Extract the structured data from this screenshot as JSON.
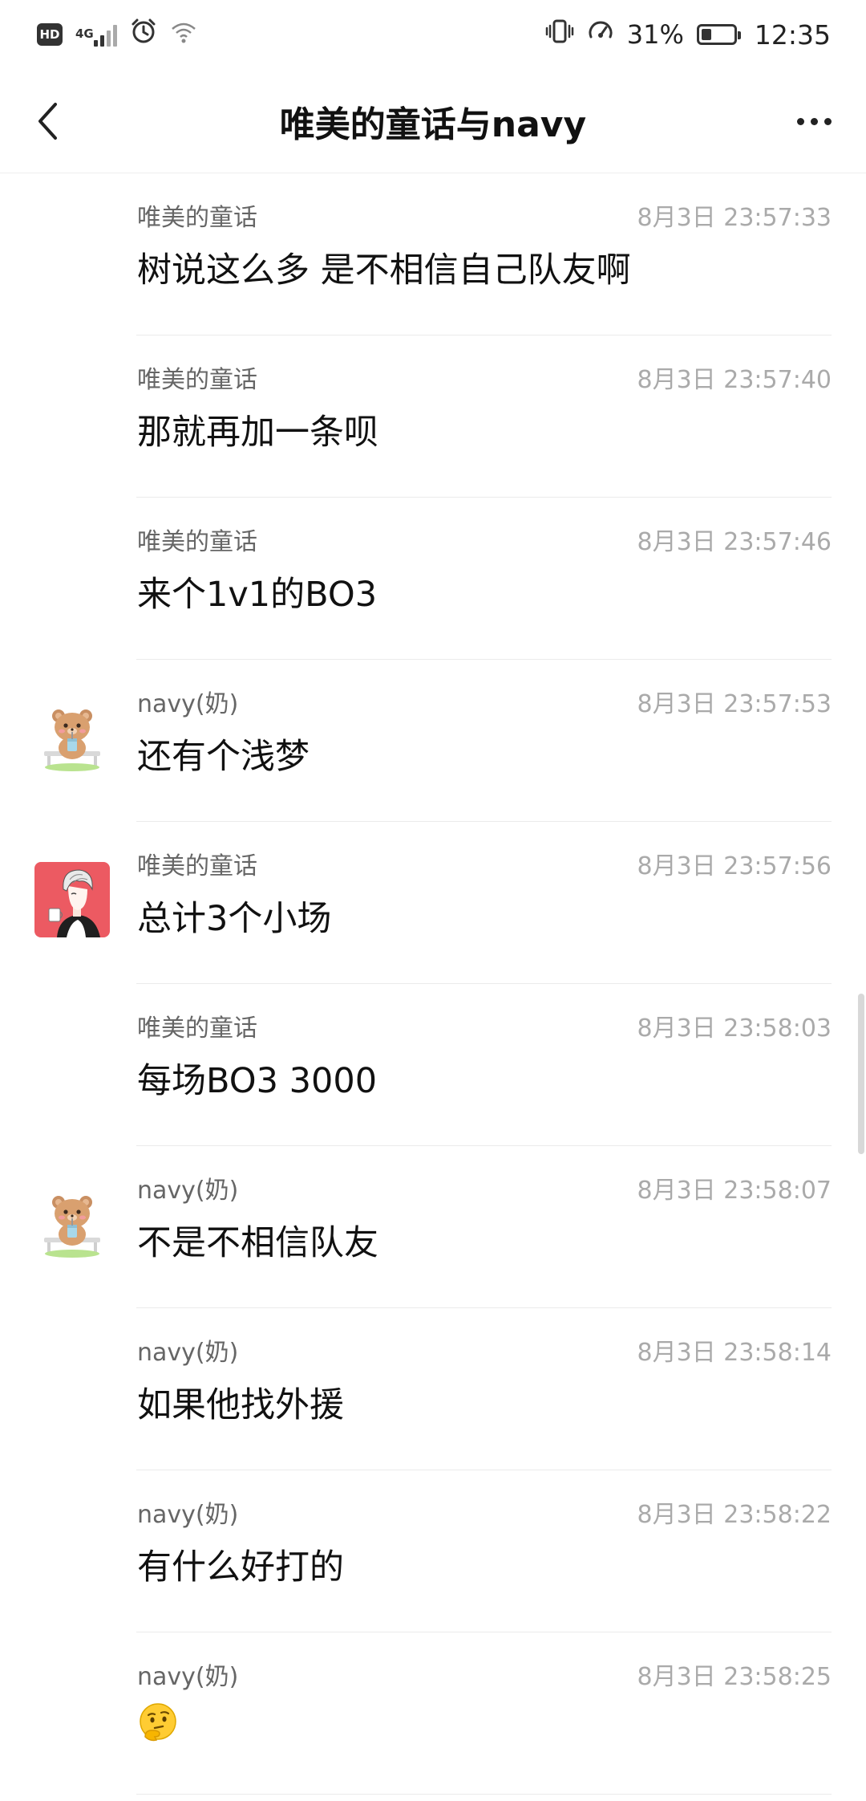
{
  "status_bar": {
    "hd": "HD",
    "network": "4G",
    "battery_percent": "31%",
    "battery_level": 0.31,
    "time": "12:35"
  },
  "header": {
    "title": "唯美的童话与navy"
  },
  "colors": {
    "text_primary": "#111111",
    "text_secondary": "#666666",
    "text_time": "#aaaaaa",
    "divider": "#ebebeb"
  },
  "messages": [
    {
      "sender": "唯美的童话",
      "time": "8月3日 23:57:33",
      "text": "树说这么多 是不相信自己队友啊",
      "avatar": ""
    },
    {
      "sender": "唯美的童话",
      "time": "8月3日 23:57:40",
      "text": "那就再加一条呗",
      "avatar": ""
    },
    {
      "sender": "唯美的童话",
      "time": "8月3日 23:57:46",
      "text": "来个1v1的BO3",
      "avatar": ""
    },
    {
      "sender": "navy(奶)",
      "time": "8月3日 23:57:53",
      "text": "还有个浅梦",
      "avatar": "bear-avatar"
    },
    {
      "sender": "唯美的童话",
      "time": "8月3日 23:57:56",
      "text": "总计3个小场",
      "avatar": "anime-boy-avatar"
    },
    {
      "sender": "唯美的童话",
      "time": "8月3日 23:58:03",
      "text": "每场BO3 3000",
      "avatar": ""
    },
    {
      "sender": "navy(奶)",
      "time": "8月3日 23:58:07",
      "text": "不是不相信队友",
      "avatar": "bear-avatar"
    },
    {
      "sender": "navy(奶)",
      "time": "8月3日 23:58:14",
      "text": "如果他找外援",
      "avatar": ""
    },
    {
      "sender": "navy(奶)",
      "time": "8月3日 23:58:22",
      "text": "有什么好打的",
      "avatar": ""
    },
    {
      "sender": "navy(奶)",
      "time": "8月3日 23:58:25",
      "text": "",
      "emoji": "thinking-face-emoji",
      "avatar": ""
    }
  ]
}
